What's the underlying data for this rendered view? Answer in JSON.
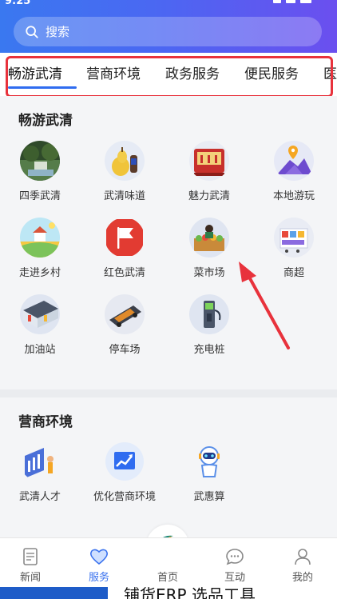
{
  "status_bar": {
    "time": "9:25"
  },
  "search": {
    "label": "搜索"
  },
  "tabs": [
    {
      "label": "畅游武清"
    },
    {
      "label": "营商环境"
    },
    {
      "label": "政务服务"
    },
    {
      "label": "便民服务"
    },
    {
      "label": "医"
    }
  ],
  "sections": [
    {
      "title": "畅游武清",
      "items": [
        {
          "label": "四季武清",
          "icon": "lake-landscape-icon"
        },
        {
          "label": "武清味道",
          "icon": "pear-fruit-icon"
        },
        {
          "label": "魅力武清",
          "icon": "theater-stage-icon"
        },
        {
          "label": "本地游玩",
          "icon": "mountain-location-icon"
        },
        {
          "label": "走进乡村",
          "icon": "village-field-icon"
        },
        {
          "label": "红色武清",
          "icon": "red-flag-icon"
        },
        {
          "label": "菜市场",
          "icon": "market-stall-icon"
        },
        {
          "label": "商超",
          "icon": "supermarket-icon"
        },
        {
          "label": "加油站",
          "icon": "gas-station-icon"
        },
        {
          "label": "停车场",
          "icon": "parking-car-icon"
        },
        {
          "label": "充电桩",
          "icon": "charging-pile-icon"
        }
      ]
    },
    {
      "title": "营商环境",
      "items": [
        {
          "label": "武清人才",
          "icon": "talent-person-icon"
        },
        {
          "label": "优化营商环境",
          "icon": "growth-chart-icon"
        },
        {
          "label": "武惠算",
          "icon": "robot-icon"
        }
      ]
    }
  ],
  "bottom_nav": [
    {
      "label": "新闻",
      "icon": "news-icon"
    },
    {
      "label": "服务",
      "icon": "heart-service-icon",
      "active": true
    },
    {
      "label": "首页",
      "icon": "home-logo-icon"
    },
    {
      "label": "互动",
      "icon": "chat-bubble-icon"
    },
    {
      "label": "我的",
      "icon": "profile-icon"
    }
  ],
  "background_text": "铺货ERP 选品工具",
  "colors": {
    "accent": "#3a72ee",
    "highlight_box": "#e8323c",
    "header_gradient_start": "#3a78f0",
    "header_gradient_end": "#6b4fef"
  }
}
